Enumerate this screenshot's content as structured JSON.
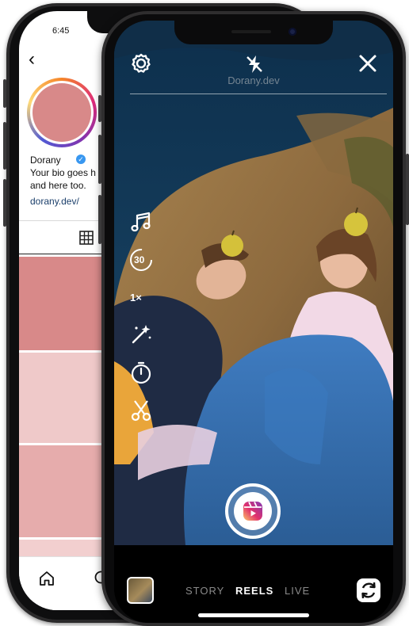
{
  "back_phone": {
    "status_time": "6:45",
    "profile": {
      "name": "Dorany",
      "bio_line1": "Your bio goes h",
      "bio_line2": "and here too.",
      "link": "dorany.dev/"
    },
    "tile_colors": [
      "#d88989",
      "#efc9c9",
      "#e6acac",
      "#f2cfcf"
    ],
    "avatar_color": "#d88989"
  },
  "front_phone": {
    "ghost_header": "Dorany.dev",
    "tools": {
      "timer": "30",
      "speed": "1×"
    },
    "modes": [
      {
        "label": "STORY",
        "active": false
      },
      {
        "label": "REELS",
        "active": true
      },
      {
        "label": "LIVE",
        "active": false
      }
    ],
    "icons": {
      "settings": "settings-gear-icon",
      "flash": "flash-off-icon",
      "close": "close-icon",
      "music": "music-icon",
      "speed": "speed-icon",
      "effects": "effects-wand-icon",
      "timer": "timer-icon",
      "align": "align-cut-icon",
      "reels": "reels-icon",
      "flip": "flip-camera-icon"
    },
    "accent": "#e1306c"
  }
}
